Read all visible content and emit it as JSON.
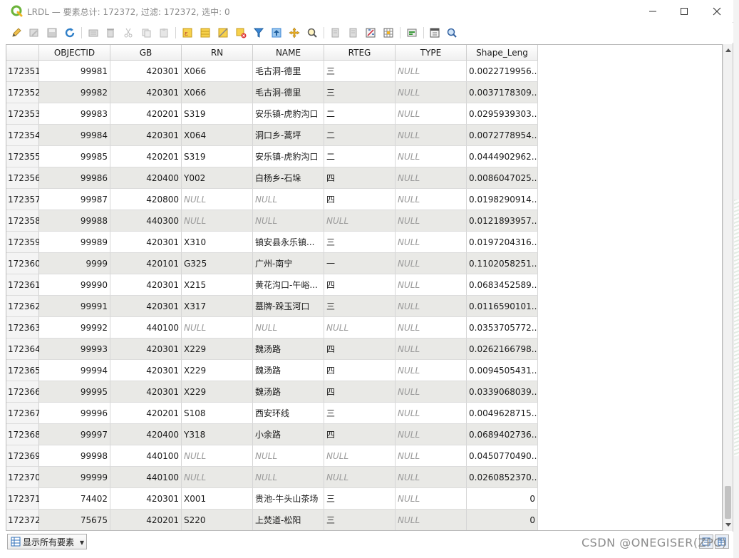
{
  "window": {
    "title": "LRDL — 要素总计: 172372, 过滤: 172372, 选中: 0"
  },
  "toolbar": {
    "icons": [
      "pencil-icon",
      "multi-edit-icon",
      "save-icon",
      "reload-icon",
      "add-feature-icon",
      "delete-icon",
      "cut-icon",
      "copy-icon",
      "paste-icon",
      "select-expression-icon",
      "select-all-icon",
      "invert-selection-icon",
      "deselect-icon",
      "filter-icon",
      "move-selection-top-icon",
      "pan-to-selection-icon",
      "zoom-to-selection-icon",
      "new-field-icon",
      "delete-field-icon",
      "field-calculator-icon",
      "conditional-format-icon",
      "actions-icon",
      "dock-icon",
      "identify-icon"
    ]
  },
  "table": {
    "columns": [
      "OBJECTID",
      "GB",
      "RN",
      "NAME",
      "RTEG",
      "TYPE",
      "Shape_Leng"
    ],
    "rows": [
      {
        "id": "172351",
        "cells": [
          "99981",
          "420301",
          "X066",
          "毛古洞-德里",
          "三",
          "NULL",
          "0.0022719956..."
        ]
      },
      {
        "id": "172352",
        "cells": [
          "99982",
          "420301",
          "X066",
          "毛古洞-德里",
          "三",
          "NULL",
          "0.0037178309..."
        ]
      },
      {
        "id": "172353",
        "cells": [
          "99983",
          "420201",
          "S319",
          "安乐镇-虎豹沟口",
          "二",
          "NULL",
          "0.0295939303..."
        ]
      },
      {
        "id": "172354",
        "cells": [
          "99984",
          "420301",
          "X064",
          "洞口乡-蒿坪",
          "二",
          "NULL",
          "0.0072778954..."
        ]
      },
      {
        "id": "172355",
        "cells": [
          "99985",
          "420201",
          "S319",
          "安乐镇-虎豹沟口",
          "二",
          "NULL",
          "0.0444902962..."
        ]
      },
      {
        "id": "172356",
        "cells": [
          "99986",
          "420400",
          "Y002",
          "白杨乡-石垛",
          "四",
          "NULL",
          "0.0086047025..."
        ]
      },
      {
        "id": "172357",
        "cells": [
          "99987",
          "420800",
          "NULL",
          "NULL",
          "四",
          "NULL",
          "0.0198290914..."
        ]
      },
      {
        "id": "172358",
        "cells": [
          "99988",
          "440300",
          "NULL",
          "NULL",
          "NULL",
          "NULL",
          "0.0121893957..."
        ]
      },
      {
        "id": "172359",
        "cells": [
          "99989",
          "420301",
          "X310",
          "镇安县永乐镇...",
          "三",
          "NULL",
          "0.0197204316..."
        ]
      },
      {
        "id": "172360",
        "cells": [
          "9999",
          "420101",
          "G325",
          "广州-南宁",
          "一",
          "NULL",
          "0.1102058251..."
        ]
      },
      {
        "id": "172361",
        "cells": [
          "99990",
          "420301",
          "X215",
          "黄花沟口-午峪...",
          "四",
          "NULL",
          "0.0683452589..."
        ]
      },
      {
        "id": "172362",
        "cells": [
          "99991",
          "420301",
          "X317",
          "墓牌-跺玉河口",
          "三",
          "NULL",
          "0.0116590101..."
        ]
      },
      {
        "id": "172363",
        "cells": [
          "99992",
          "440100",
          "NULL",
          "NULL",
          "NULL",
          "NULL",
          "0.0353705772..."
        ]
      },
      {
        "id": "172364",
        "cells": [
          "99993",
          "420301",
          "X229",
          "魏汤路",
          "四",
          "NULL",
          "0.0262166798..."
        ]
      },
      {
        "id": "172365",
        "cells": [
          "99994",
          "420301",
          "X229",
          "魏汤路",
          "四",
          "NULL",
          "0.0094505431..."
        ]
      },
      {
        "id": "172366",
        "cells": [
          "99995",
          "420301",
          "X229",
          "魏汤路",
          "四",
          "NULL",
          "0.0339068039..."
        ]
      },
      {
        "id": "172367",
        "cells": [
          "99996",
          "420201",
          "S108",
          "西安环线",
          "三",
          "NULL",
          "0.0049628715..."
        ]
      },
      {
        "id": "172368",
        "cells": [
          "99997",
          "420400",
          "Y318",
          "小余路",
          "四",
          "NULL",
          "0.0689402736..."
        ]
      },
      {
        "id": "172369",
        "cells": [
          "99998",
          "440100",
          "NULL",
          "NULL",
          "NULL",
          "NULL",
          "0.0450770490..."
        ]
      },
      {
        "id": "172370",
        "cells": [
          "99999",
          "440100",
          "NULL",
          "NULL",
          "NULL",
          "NULL",
          "0.0260852370..."
        ]
      },
      {
        "id": "172371",
        "cells": [
          "74402",
          "420301",
          "X001",
          "贵池-牛头山茶场",
          "三",
          "NULL",
          "0"
        ]
      },
      {
        "id": "172372",
        "cells": [
          "75675",
          "420201",
          "S220",
          "上焚道-松阳",
          "三",
          "NULL",
          "0"
        ]
      }
    ]
  },
  "bottom": {
    "filter_label": "显示所有要素"
  },
  "watermark": "CSDN @ONEGISER(ZPC)",
  "colors": {
    "alt_row": "#e9e9e6",
    "null_text": "#9a9a9a",
    "accent": "#2f8ad8"
  }
}
